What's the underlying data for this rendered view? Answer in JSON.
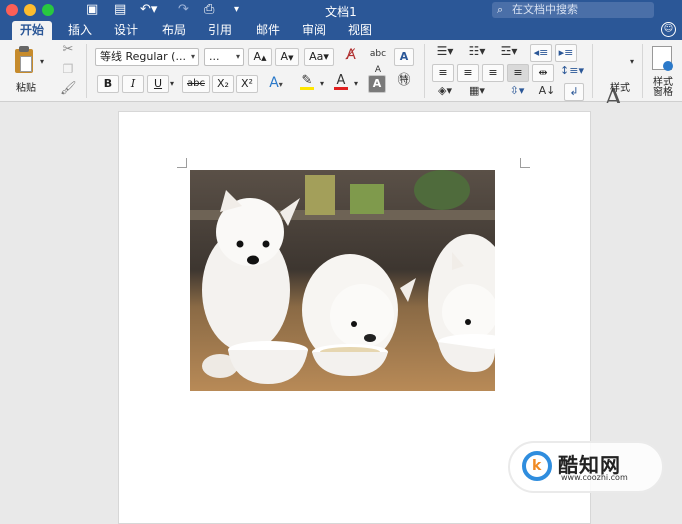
{
  "window": {
    "title": "文档1",
    "search_placeholder": "在文档中搜索"
  },
  "tabs": [
    {
      "label": "开始",
      "active": true
    },
    {
      "label": "插入"
    },
    {
      "label": "设计"
    },
    {
      "label": "布局"
    },
    {
      "label": "引用"
    },
    {
      "label": "邮件"
    },
    {
      "label": "审阅"
    },
    {
      "label": "视图"
    }
  ],
  "ribbon": {
    "paste_label": "粘贴",
    "font_name": "等线 Regular (...",
    "font_size": "...",
    "bold": "B",
    "italic": "I",
    "underline": "U",
    "strikethrough": "abc",
    "subscript": "X₂",
    "superscript": "X²",
    "styles_label": "样式",
    "styles_pane_label_1": "样式",
    "styles_pane_label_2": "窗格",
    "highlight_color": "#ffe600",
    "font_color": "#e02020"
  },
  "document": {
    "image_description": "three white puppies eating from bowls"
  },
  "watermark": {
    "brand": "酷知网",
    "url": "www.coozhi.com"
  },
  "colors": {
    "titlebar": "#2b5797",
    "ribbon": "#f3f3f3"
  }
}
